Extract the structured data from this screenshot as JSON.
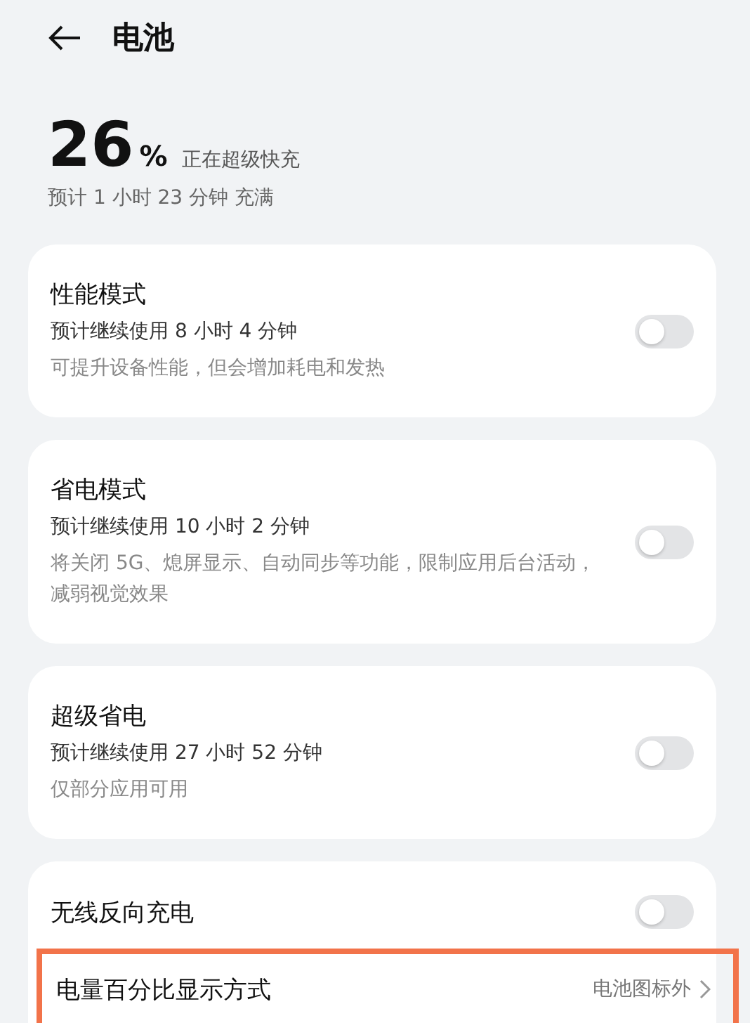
{
  "header": {
    "title": "电池"
  },
  "battery": {
    "percent": "26",
    "unit": "%",
    "status": "正在超级快充",
    "estimate": "预计 1 小时 23 分钟 充满"
  },
  "cards": [
    {
      "rows": [
        {
          "kind": "toggle",
          "title": "性能模式",
          "usage": "预计继续使用 8 小时 4 分钟",
          "note": "可提升设备性能，但会增加耗电和发热",
          "on": false
        }
      ]
    },
    {
      "rows": [
        {
          "kind": "toggle",
          "title": "省电模式",
          "usage": "预计继续使用 10 小时 2 分钟",
          "note": "将关闭 5G、熄屏显示、自动同步等功能，限制应用后台活动，减弱视觉效果",
          "on": false
        }
      ]
    },
    {
      "rows": [
        {
          "kind": "toggle",
          "title": "超级省电",
          "usage": "预计继续使用 27 小时 52 分钟",
          "note": "仅部分应用可用",
          "on": false
        }
      ]
    },
    {
      "rows": [
        {
          "kind": "toggle",
          "title": "无线反向充电",
          "on": false
        },
        {
          "kind": "link",
          "title": "电量百分比显示方式",
          "value": "电池图标外",
          "highlighted": true
        }
      ]
    }
  ]
}
